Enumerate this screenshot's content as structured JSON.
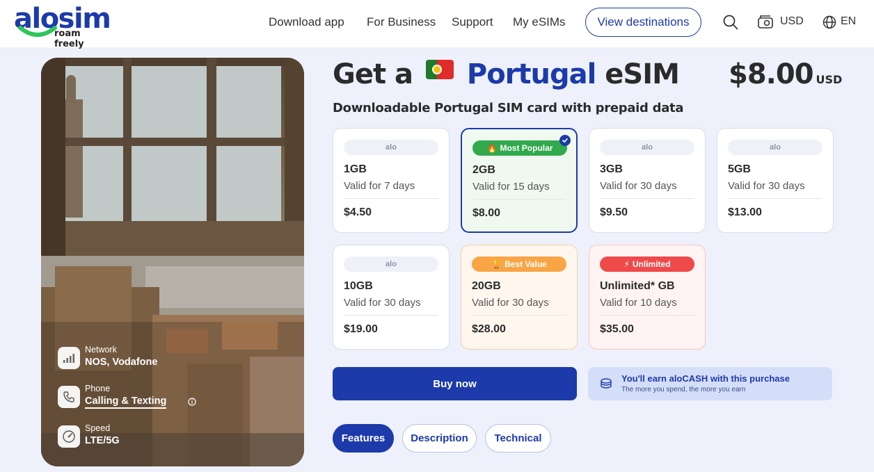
{
  "header": {
    "logo_word": "alosim",
    "logo_tagline": "roam freely",
    "nav": [
      "Download app",
      "For Business",
      "Support",
      "My eSIMs"
    ],
    "cta": "View destinations",
    "currency": "USD",
    "language": "EN"
  },
  "hero": {
    "specs": [
      {
        "label": "Network",
        "value": "NOS, Vodafone",
        "icon": "signal-bars-icon"
      },
      {
        "label": "Phone",
        "value": "Calling & Texting",
        "icon": "phone-icon"
      },
      {
        "label": "Speed",
        "value": "LTE/5G",
        "icon": "speedometer-icon"
      }
    ]
  },
  "product": {
    "title_prefix": "Get a",
    "country": "Portugal",
    "title_suffix": "eSIM",
    "price": "$8.00",
    "price_currency": "USD",
    "subtitle": "Downloadable Portugal SIM card with prepaid data"
  },
  "plans": [
    {
      "badge": "alo",
      "data": "1GB",
      "validity": "Valid for 7 days",
      "price": "$4.50"
    },
    {
      "badge": "Most Popular",
      "data": "2GB",
      "validity": "Valid for 15 days",
      "price": "$8.00",
      "selected": true
    },
    {
      "badge": "alo",
      "data": "3GB",
      "validity": "Valid for 30 days",
      "price": "$9.50"
    },
    {
      "badge": "alo",
      "data": "5GB",
      "validity": "Valid for 30 days",
      "price": "$13.00"
    },
    {
      "badge": "alo",
      "data": "10GB",
      "validity": "Valid for 30 days",
      "price": "$19.00"
    },
    {
      "badge": "Best Value",
      "data": "20GB",
      "validity": "Valid for 30 days",
      "price": "$28.00"
    },
    {
      "badge": "Unlimited",
      "data": "Unlimited* GB",
      "validity": "Valid for 10 days",
      "price": "$35.00"
    }
  ],
  "actions": {
    "buy": "Buy now",
    "earn_title": "You'll earn aloCASH with this purchase",
    "earn_sub": "The more you spend, the more you earn"
  },
  "tabs": [
    "Features",
    "Description",
    "Technical"
  ],
  "colors": {
    "brand": "#1c3aa9",
    "accent_green": "#31a94d",
    "accent_orange": "#f9a545",
    "accent_red": "#ee4a4a",
    "page_bg": "#eef1fb"
  }
}
